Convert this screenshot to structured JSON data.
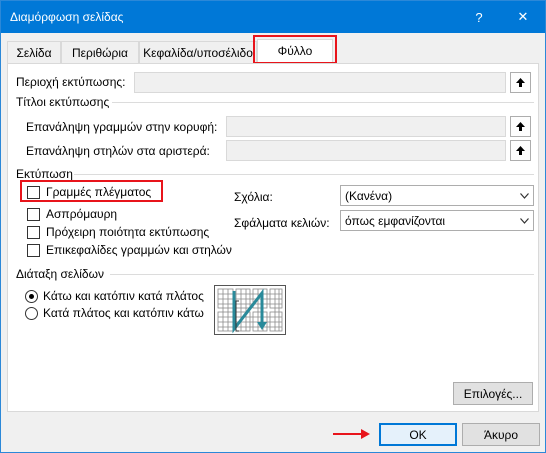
{
  "window": {
    "title": "Διαμόρφωση σελίδας",
    "help_glyph": "?",
    "close_glyph": "✕"
  },
  "tabs": [
    {
      "label": "Σελίδα"
    },
    {
      "label": "Περιθώρια"
    },
    {
      "label": "Κεφαλίδα/υποσέλιδο"
    },
    {
      "label": "Φύλλο"
    }
  ],
  "print_area": {
    "label": "Περιοχή εκτύπωσης:",
    "value": ""
  },
  "print_titles": {
    "heading": "Τίτλοι εκτύπωσης",
    "rows_label": "Επανάληψη γραμμών στην κορυφή:",
    "rows_value": "",
    "cols_label": "Επανάληψη στηλών στα αριστερά:",
    "cols_value": ""
  },
  "print": {
    "heading": "Εκτύπωση",
    "options": [
      {
        "label": "Γραμμές πλέγματος",
        "checked": false
      },
      {
        "label": "Ασπρόμαυρη",
        "checked": false
      },
      {
        "label": "Πρόχειρη ποιότητα εκτύπωσης",
        "checked": false
      },
      {
        "label": "Επικεφαλίδες γραμμών και στηλών",
        "checked": false
      }
    ],
    "comments_label": "Σχόλια:",
    "comments_value": "(Κανένα)",
    "errors_label": "Σφάλματα κελιών:",
    "errors_value": "όπως εμφανίζονται"
  },
  "page_order": {
    "heading": "Διάταξη σελίδων",
    "options": [
      {
        "label": "Κάτω και κατόπιν κατά πλάτος",
        "selected": true
      },
      {
        "label": "Κατά πλάτος και κατόπιν κάτω",
        "selected": false
      }
    ]
  },
  "buttons": {
    "options": "Επιλογές...",
    "ok": "OK",
    "cancel": "Άκυρο"
  },
  "colors": {
    "accent": "#0078d7",
    "highlight": "#e8141b",
    "preview_arrow": "#2a8a9a"
  }
}
